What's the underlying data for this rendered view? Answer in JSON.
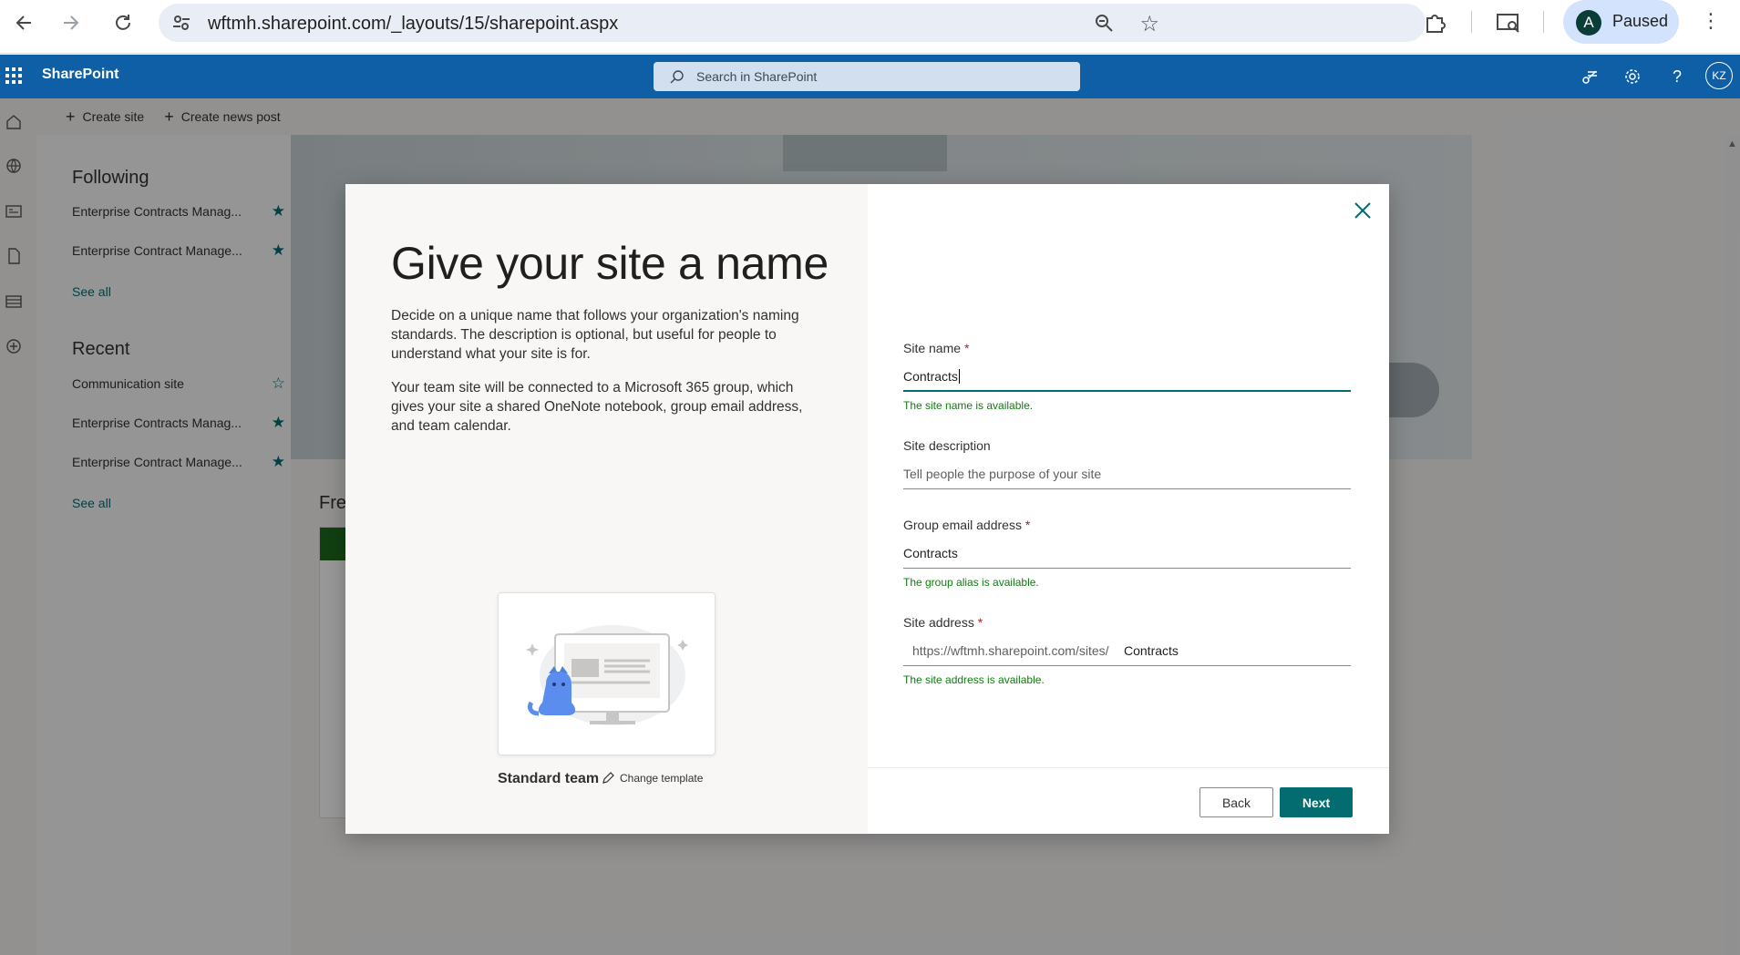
{
  "browser": {
    "url": "wftmh.sharepoint.com/_layouts/15/sharepoint.aspx",
    "profile_initial": "A",
    "profile_status": "Paused"
  },
  "suite": {
    "brand": "SharePoint",
    "search_placeholder": "Search in SharePoint",
    "avatar_initials": "KZ"
  },
  "commands": {
    "create_site": "Create site",
    "create_news": "Create news post"
  },
  "leftnav": {
    "following_title": "Following",
    "following": [
      {
        "label": "Enterprise Contracts Manag...",
        "starred": true
      },
      {
        "label": "Enterprise Contract Manage...",
        "starred": true
      }
    ],
    "see_all_following": "See all",
    "recent_title": "Recent",
    "recent": [
      {
        "label": "Communication site",
        "starred": false
      },
      {
        "label": "Enterprise Contracts Manag...",
        "starred": true
      },
      {
        "label": "Enterprise Contract Manage...",
        "starred": true
      }
    ],
    "see_all_recent": "See all"
  },
  "background": {
    "frequent_heading": "Fre"
  },
  "dialog": {
    "title": "Give your site a name",
    "desc1": "Decide on a unique name that follows your organization's naming standards. The description is optional, but useful for people to understand what your site is for.",
    "desc2": "Your team site will be connected to a Microsoft 365 group, which gives your site a shared OneNote notebook, group email address, and team calendar.",
    "template_name": "Standard team",
    "change_template": "Change template",
    "site_name_label": "Site name",
    "site_name_value": "Contracts",
    "site_name_msg": "The site name is available.",
    "site_desc_label": "Site description",
    "site_desc_placeholder": "Tell people the purpose of your site",
    "group_email_label": "Group email address",
    "group_email_value": "Contracts",
    "group_email_msg": "The group alias is available.",
    "site_address_label": "Site address",
    "site_address_prefix": "https://wftmh.sharepoint.com/sites/",
    "site_address_value": "Contracts",
    "site_address_msg": "The site address is available.",
    "back_label": "Back",
    "next_label": "Next",
    "accent_color": "#036c70"
  }
}
